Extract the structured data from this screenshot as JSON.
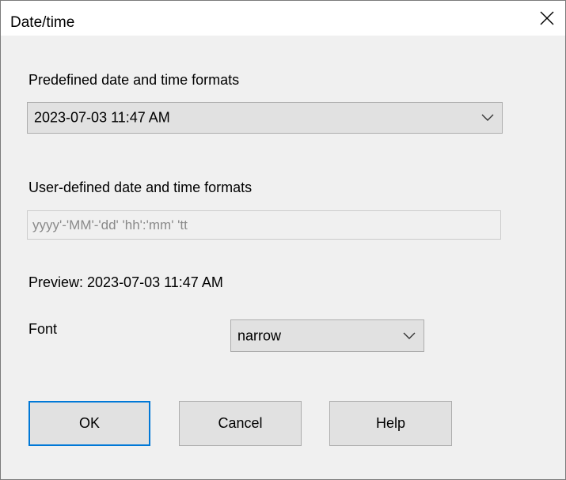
{
  "window": {
    "title": "Date/time",
    "close_icon": "close-icon"
  },
  "predefined": {
    "label": "Predefined date and time formats",
    "selected": "2023-07-03 11:47 AM"
  },
  "user_defined": {
    "label": "User-defined date and time formats",
    "value": "",
    "placeholder": "yyyy'-'MM'-'dd' 'hh':'mm' 'tt"
  },
  "preview": {
    "text": "Preview: 2023-07-03 11:47 AM"
  },
  "font": {
    "label": "Font",
    "selected": "narrow"
  },
  "buttons": {
    "ok": "OK",
    "cancel": "Cancel",
    "help": "Help"
  },
  "colors": {
    "focus_border": "#0078d7",
    "button_face": "#e1e1e1",
    "dialog_background": "#f0f0f0"
  }
}
